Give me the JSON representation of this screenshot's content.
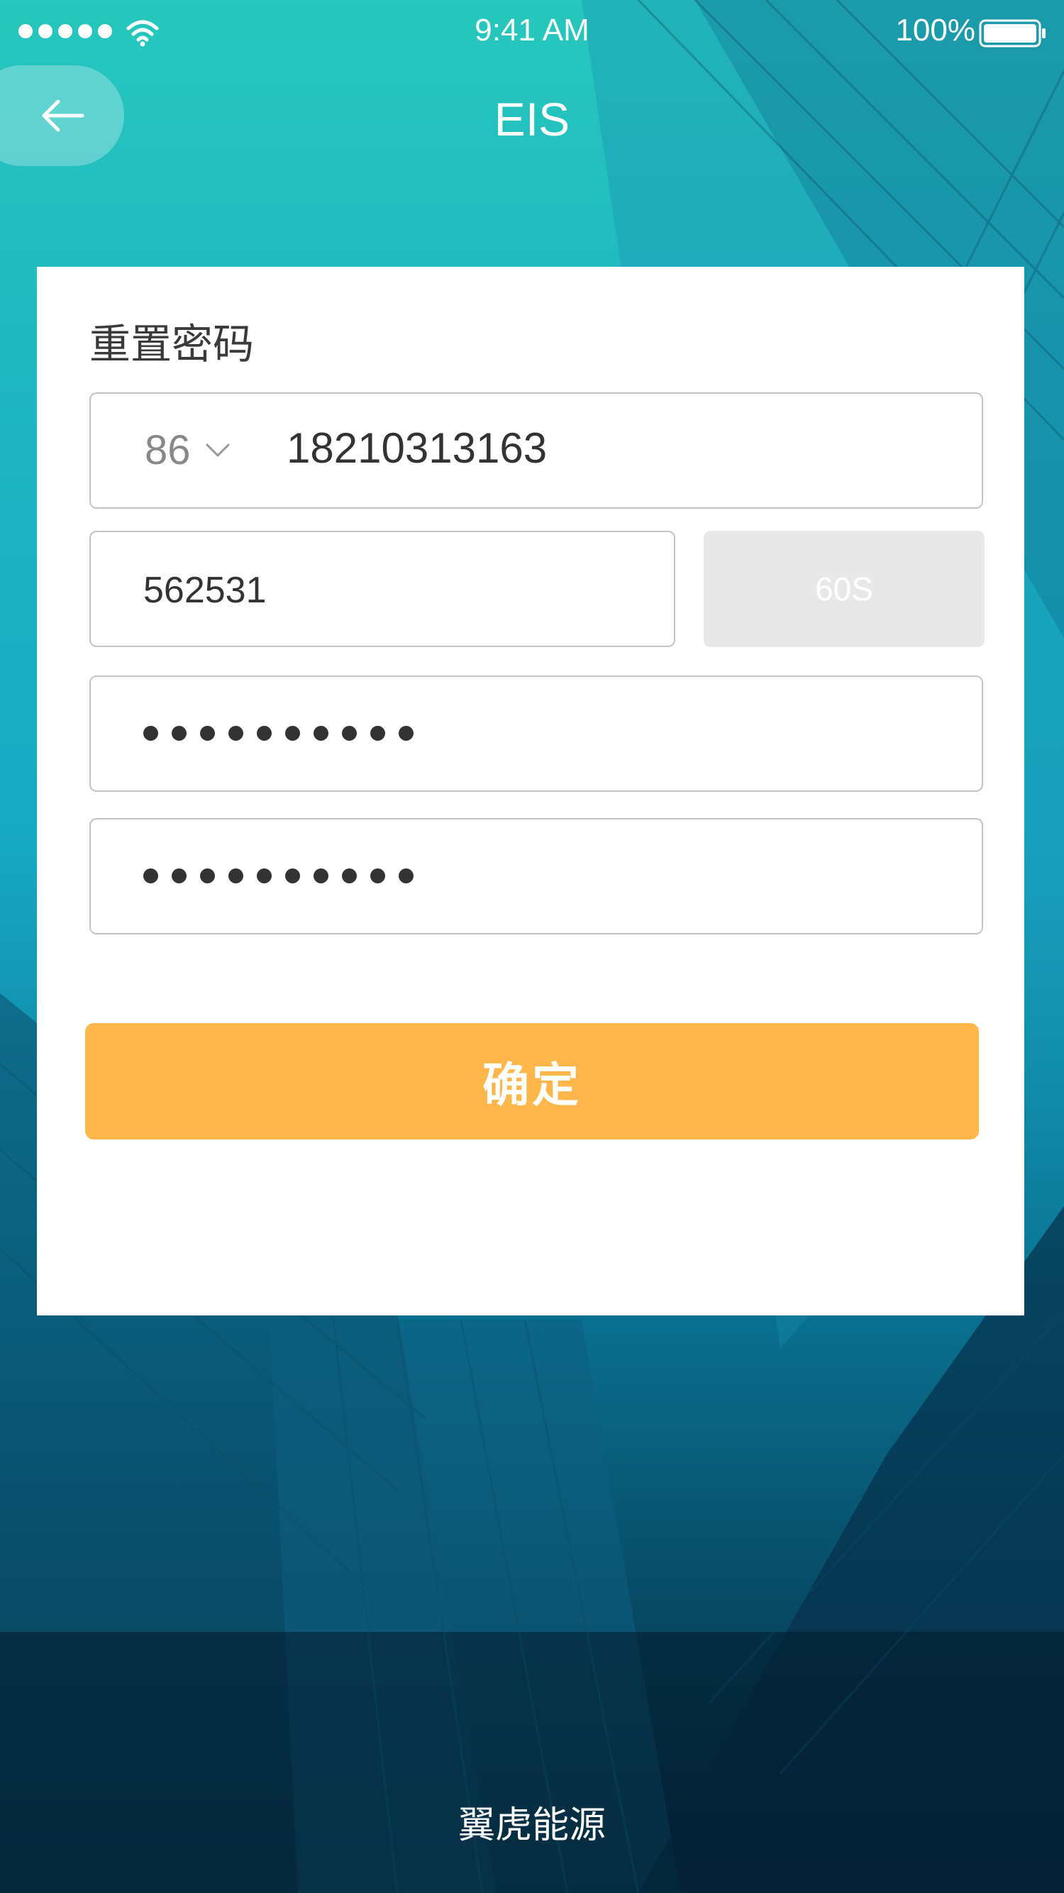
{
  "status_bar": {
    "time": "9:41 AM",
    "battery_percent": "100%",
    "signal_bars": 5,
    "icons": [
      "signal-dots-icon",
      "wifi-icon",
      "battery-icon"
    ]
  },
  "nav": {
    "title": "EIS",
    "back_icon": "arrow-left-icon"
  },
  "form": {
    "title": "重置密码",
    "country_code": "86",
    "country_code_icon": "chevron-down-icon",
    "phone": "18210313163",
    "verification_code": "562531",
    "countdown_label": "60S",
    "password_mask_length": 10,
    "confirm_password_mask_length": 10,
    "submit_label": "确定"
  },
  "footer": {
    "brand": "翼虎能源"
  },
  "colors": {
    "accent_orange": "#ffb64a",
    "teal_top": "#27c7bd",
    "disabled_gray": "#e8e8e8"
  }
}
